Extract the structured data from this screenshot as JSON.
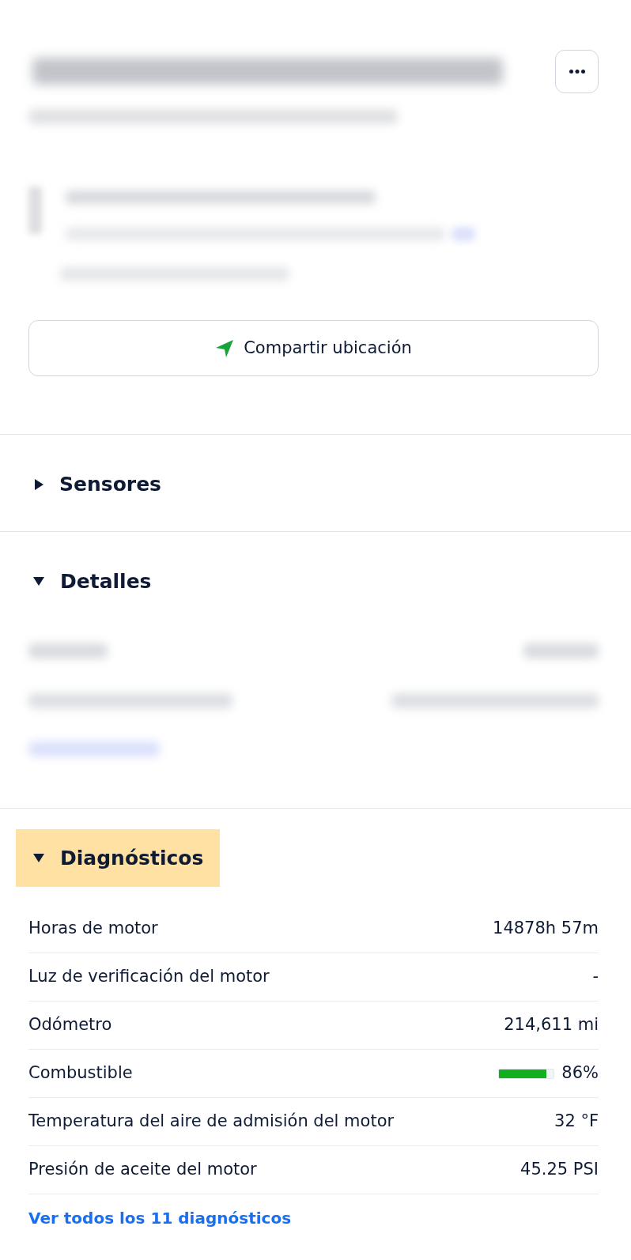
{
  "share_button": {
    "label": "Compartir ubicación"
  },
  "sections": [
    {
      "title": "Sensores",
      "expanded": false,
      "highlighted": false
    },
    {
      "title": "Detalles",
      "expanded": true,
      "highlighted": false
    },
    {
      "title": "Diagnósticos",
      "expanded": true,
      "highlighted": true,
      "rows": [
        {
          "kind": "text",
          "label": "Horas de motor",
          "value": "14878h 57m"
        },
        {
          "kind": "text",
          "label": "Luz de verificación del motor",
          "value": "-"
        },
        {
          "kind": "text",
          "label": "Odómetro",
          "value": "214,611 mi"
        },
        {
          "kind": "meter",
          "label": "Combustible",
          "level": 0.86,
          "value": "86%"
        },
        {
          "kind": "text",
          "label": "Temperatura del aire de admisión del motor",
          "value": "32 °F"
        },
        {
          "kind": "text",
          "label": "Presión de aceite del motor",
          "value": "45.25 PSI"
        }
      ],
      "link": "Ver todos los 11 diagnósticos"
    }
  ]
}
